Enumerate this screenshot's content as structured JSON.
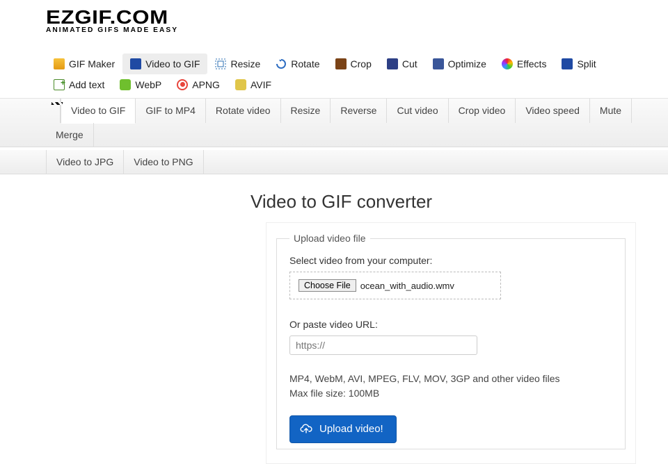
{
  "brand": {
    "name": "EZGIF.COM",
    "tagline": "ANIMATED GIFS MADE EASY"
  },
  "main_nav": [
    {
      "label": "GIF Maker"
    },
    {
      "label": "Video to GIF",
      "active": true
    },
    {
      "label": "Resize"
    },
    {
      "label": "Rotate"
    },
    {
      "label": "Crop"
    },
    {
      "label": "Cut"
    },
    {
      "label": "Optimize"
    },
    {
      "label": "Effects"
    },
    {
      "label": "Split"
    },
    {
      "label": "Add text"
    },
    {
      "label": "WebP"
    },
    {
      "label": "APNG"
    },
    {
      "label": "AVIF"
    }
  ],
  "sub_nav_row1": [
    {
      "label": "Video to GIF",
      "active": true
    },
    {
      "label": "GIF to MP4"
    },
    {
      "label": "Rotate video"
    },
    {
      "label": "Resize"
    },
    {
      "label": "Reverse"
    },
    {
      "label": "Cut video"
    },
    {
      "label": "Crop video"
    },
    {
      "label": "Video speed"
    },
    {
      "label": "Mute"
    },
    {
      "label": "Merge"
    }
  ],
  "sub_nav_row2": [
    {
      "label": "Video to JPG"
    },
    {
      "label": "Video to PNG"
    }
  ],
  "page": {
    "title": "Video to GIF converter"
  },
  "upload": {
    "legend": "Upload video file",
    "select_label": "Select video from your computer:",
    "choose_button": "Choose File",
    "selected_file": "ocean_with_audio.wmv",
    "url_label": "Or paste video URL:",
    "url_placeholder": "https://",
    "formats_hint": "MP4, WebM, AVI, MPEG, FLV, MOV, 3GP and other video files",
    "size_hint": "Max file size: 100MB",
    "button": "Upload video!"
  }
}
